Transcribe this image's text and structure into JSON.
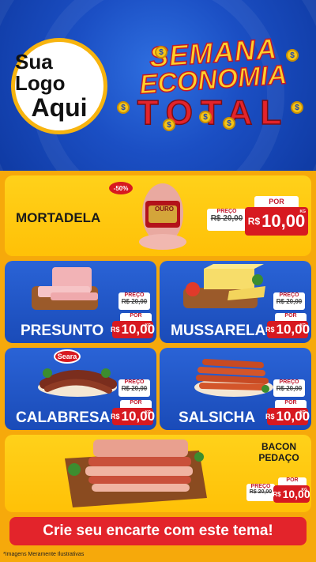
{
  "header": {
    "logo_line1": "Sua Logo",
    "logo_line2": "Aqui",
    "title_line1": "SEMANA",
    "title_line2": "ECONOMIA",
    "title_line3": "TOTAL"
  },
  "featured": {
    "name": "MORTADELA",
    "discount": "-50%",
    "brand": "OURO",
    "preco_label": "PREÇO",
    "old_price": "R$ 20,00",
    "por_label": "POR",
    "currency": "R$",
    "price": "10,00",
    "unit": "KG"
  },
  "products": [
    {
      "name": "PRESUNTO",
      "preco_label": "PREÇO",
      "old_price": "R$ 20,00",
      "por_label": "POR",
      "currency": "R$",
      "price": "10,00",
      "unit": "KG"
    },
    {
      "name": "MUSSARELA",
      "preco_label": "PREÇO",
      "old_price": "R$ 20,00",
      "por_label": "POR",
      "currency": "R$",
      "price": "10,00",
      "unit": "KG"
    },
    {
      "name": "CALABRESA",
      "brand": "Seara",
      "preco_label": "PREÇO",
      "old_price": "R$ 20,00",
      "por_label": "POR",
      "currency": "R$",
      "price": "10,00",
      "unit": "KG"
    },
    {
      "name": "SALSICHA",
      "preco_label": "PREÇO",
      "old_price": "R$ 20,00",
      "por_label": "POR",
      "currency": "R$",
      "price": "10,00",
      "unit": "KG"
    }
  ],
  "bacon": {
    "name_line1": "BACON",
    "name_line2": "PEDAÇO",
    "preco_label": "PREÇO",
    "old_price": "R$ 20,00",
    "por_label": "POR",
    "currency": "R$",
    "price": "10,00",
    "unit": "KG"
  },
  "cta": "Crie seu encarte com este tema!",
  "footnote": "*Imagens Meramente Ilustrativas",
  "colors": {
    "blue": "#1b4fc4",
    "yellow": "#ffc107",
    "red": "#d71920",
    "orange": "#f6a90b"
  }
}
